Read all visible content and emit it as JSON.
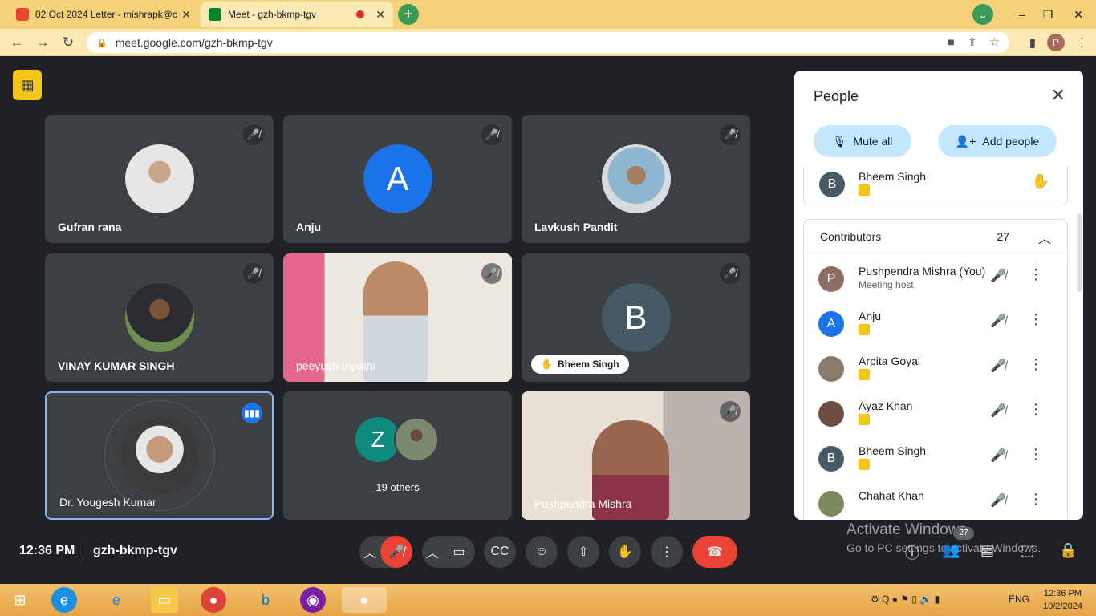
{
  "browser": {
    "tabs": [
      {
        "title": "02 Oct 2024 Letter - mishrapk@c",
        "active": false
      },
      {
        "title": "Meet - gzh-bkmp-tgv",
        "active": true
      }
    ],
    "url": "meet.google.com/gzh-bkmp-tgv",
    "profile_initial": "P",
    "new_tab_symbol": "+",
    "close_symbol": "✕",
    "collapse_symbol": "⌄",
    "window_buttons": [
      "–",
      "❐",
      "✕"
    ]
  },
  "meet": {
    "tiles": [
      {
        "name": "Gufran rana",
        "kind": "photo"
      },
      {
        "name": "Anju",
        "kind": "letter",
        "letter": "A",
        "color": "#1a73e8"
      },
      {
        "name": "Lavkush Pandit",
        "kind": "photo"
      },
      {
        "name": "VINAY KUMAR SINGH",
        "kind": "photo"
      },
      {
        "name": "peeyush tripathi",
        "kind": "video"
      },
      {
        "name": "Bheem Singh",
        "kind": "letter",
        "letter": "B",
        "color": "#455a64",
        "hand_raised": true
      },
      {
        "name": "Dr. Yougesh Kumar",
        "kind": "photo",
        "speaking": true
      },
      {
        "name": "19 others",
        "kind": "group",
        "letter": "Z",
        "color": "#0e8a7e"
      },
      {
        "name": "Pushpendra Mishra",
        "kind": "video"
      }
    ],
    "bottom": {
      "time": "12:36 PM",
      "meeting_code": "gzh-bkmp-tgv",
      "participant_count": "27"
    },
    "watermark": {
      "line1": "Activate Windows",
      "line2": "Go to PC settings to activate Windows."
    }
  },
  "people_panel": {
    "title": "People",
    "mute_all_label": "Mute all",
    "add_people_label": "Add people",
    "raised_hand": {
      "name": "Bheem Singh",
      "letter": "B",
      "color": "#455a64"
    },
    "contributors_label": "Contributors",
    "contributors_count": "27",
    "participants": [
      {
        "name": "Pushpendra Mishra (You)",
        "subtitle": "Meeting host",
        "letter": "P",
        "color": "#8d6e63"
      },
      {
        "name": "Anju",
        "subtitle": "",
        "letter": "A",
        "color": "#1a73e8"
      },
      {
        "name": "Arpita Goyal",
        "subtitle": "",
        "letter": "",
        "color": "#8a7a6a"
      },
      {
        "name": "Ayaz Khan",
        "subtitle": "",
        "letter": "",
        "color": "#6d4c41"
      },
      {
        "name": "Bheem Singh",
        "subtitle": "",
        "letter": "B",
        "color": "#455a64"
      },
      {
        "name": "Chahat Khan",
        "subtitle": "",
        "letter": "",
        "color": "#7b8a5a"
      }
    ]
  },
  "taskbar": {
    "lang": "ENG",
    "time": "12:36 PM",
    "date": "10/2/2024"
  }
}
